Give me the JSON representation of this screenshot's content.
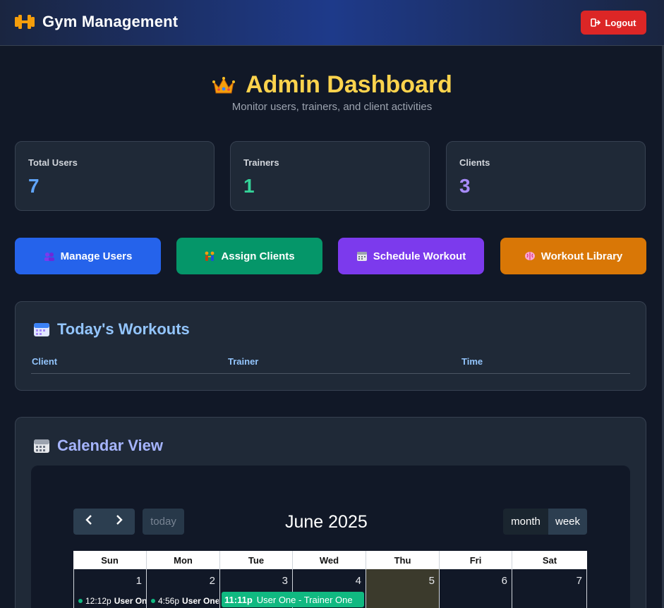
{
  "header": {
    "app_title": "Gym Management",
    "logout_label": "Logout"
  },
  "page": {
    "title": "Admin Dashboard",
    "subtitle": "Monitor users, trainers, and client activities"
  },
  "stats": [
    {
      "label": "Total Users",
      "value": "7",
      "color": "#60a5fa"
    },
    {
      "label": "Trainers",
      "value": "1",
      "color": "#34d399"
    },
    {
      "label": "Clients",
      "value": "3",
      "color": "#a78bfa"
    }
  ],
  "actions": [
    {
      "label": "Manage Users",
      "icon": "users-icon",
      "color": "#2563eb"
    },
    {
      "label": "Assign Clients",
      "icon": "people-icon",
      "color": "#059669"
    },
    {
      "label": "Schedule Workout",
      "icon": "calendar-icon",
      "color": "#7c3aed"
    },
    {
      "label": "Workout Library",
      "icon": "brain-icon",
      "color": "#d97706"
    }
  ],
  "todays_workouts": {
    "title": "Today's Workouts",
    "columns": [
      "Client",
      "Trainer",
      "Time"
    ],
    "rows": []
  },
  "calendar": {
    "title": "Calendar View",
    "today_label": "today",
    "month_label": "June 2025",
    "view_month_label": "month",
    "view_week_label": "week",
    "weekdays": [
      "Sun",
      "Mon",
      "Tue",
      "Wed",
      "Thu",
      "Fri",
      "Sat"
    ],
    "days": [
      "1",
      "2",
      "3",
      "4",
      "5",
      "6",
      "7"
    ],
    "events": [
      {
        "time": "12:12p",
        "title": "User One"
      },
      {
        "time": "4:56p",
        "title": "User One"
      },
      {
        "time": "11:11p",
        "title": "User One - Trainer One"
      }
    ]
  }
}
